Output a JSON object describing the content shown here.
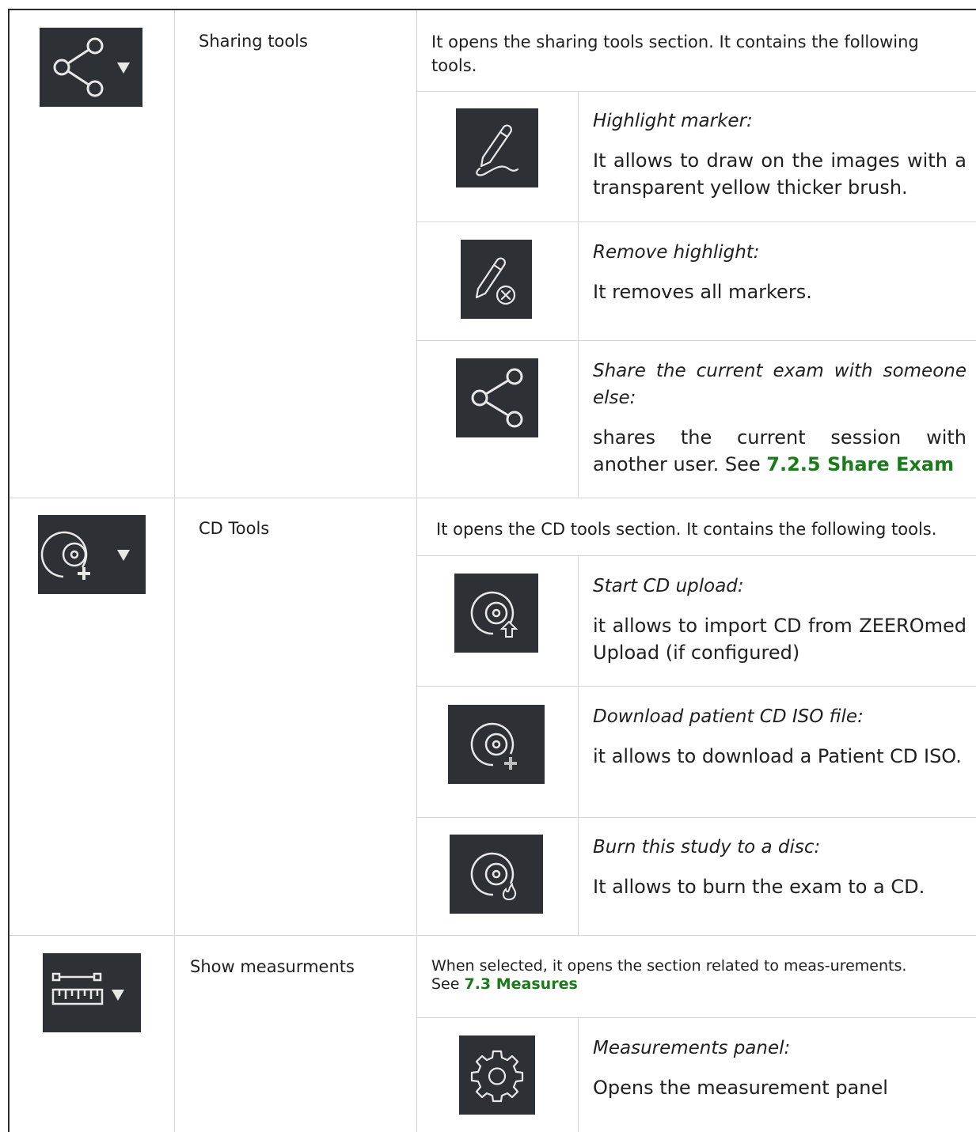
{
  "rows": [
    {
      "name": "Sharing tools",
      "icon": "share-dropdown-icon",
      "description": "It opens the sharing tools section. It contains the following tools.",
      "subtools": [
        {
          "icon": "highlight-marker-icon",
          "title": "Highlight marker:",
          "desc": "It allows to draw on the images with a transparent yellow thicker brush."
        },
        {
          "icon": "remove-highlight-icon",
          "title": "Remove highlight:",
          "desc": "It removes all markers."
        },
        {
          "icon": "share-icon",
          "title": "Share the current exam with someone else:",
          "desc": "shares the current session with another user. See ",
          "link": "7.2.5 Share Exam"
        }
      ]
    },
    {
      "name": "CD Tools",
      "icon": "cd-dropdown-icon",
      "description": "It opens the CD tools section. It contains the following tools.",
      "subtools": [
        {
          "icon": "cd-upload-icon",
          "title": "Start CD upload:",
          "desc": "it allows to import CD from ZEEROmed Upload (if configured)"
        },
        {
          "icon": "cd-download-icon",
          "title": "Download patient CD ISO file:",
          "desc": "it allows to download a Patient CD ISO."
        },
        {
          "icon": "cd-burn-icon",
          "title": "Burn this study to a disc:",
          "desc": "It allows to burn the exam to a CD."
        }
      ]
    },
    {
      "name": "Show measurments",
      "icon": "ruler-dropdown-icon",
      "description": "When selected, it opens the section related to meas-urements. See ",
      "link": "7.3 Measures",
      "subtools": [
        {
          "icon": "gear-icon",
          "title": "Measurements panel:",
          "desc": "Opens the measurement panel"
        }
      ]
    }
  ]
}
